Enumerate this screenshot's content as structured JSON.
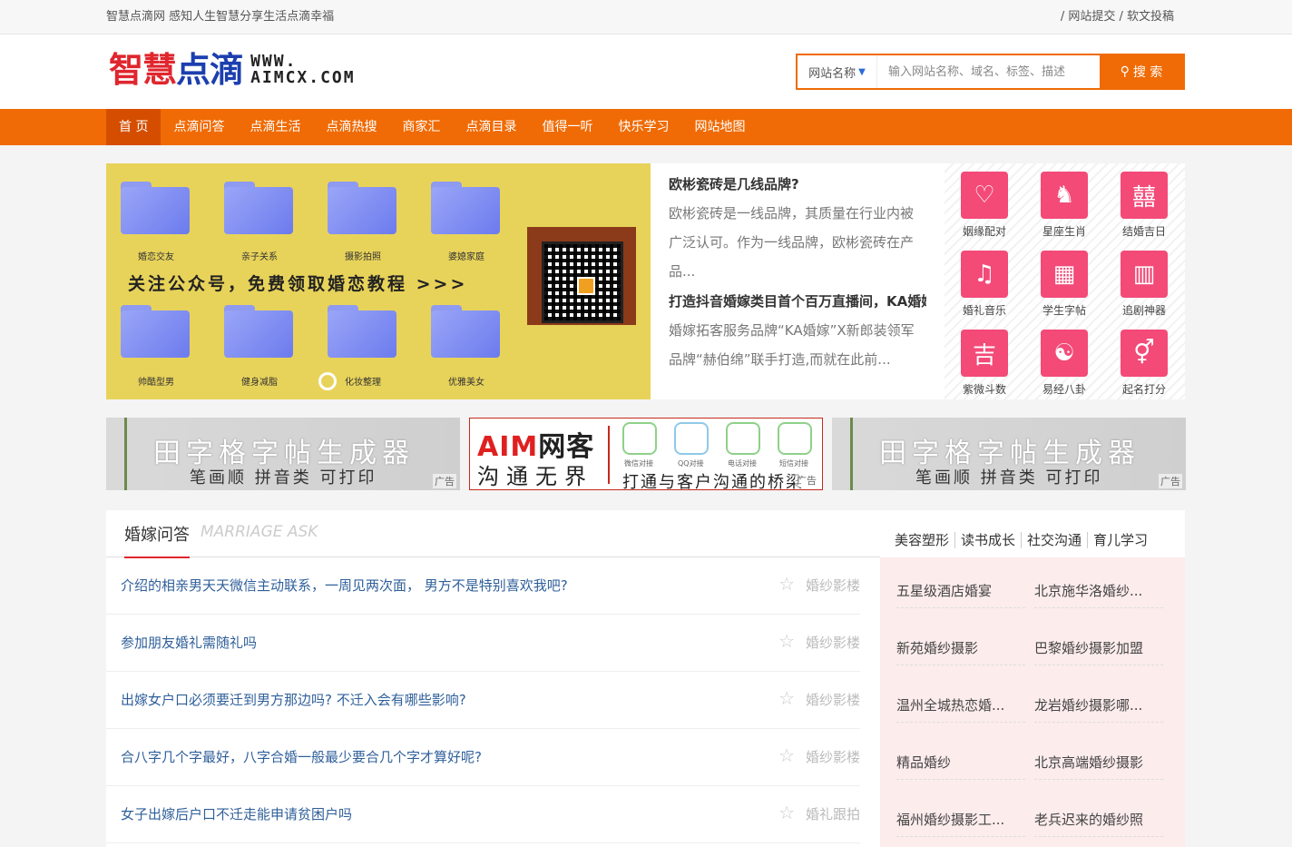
{
  "topbar": {
    "left_text": "智慧点滴网 感知人生智慧分享生活点滴幸福",
    "right_text": "/ 网站提交 / 软文投稿"
  },
  "logo": {
    "cn": [
      "智",
      "慧",
      "点",
      "滴"
    ],
    "en_line1": "WWW.",
    "en_line2": "AIMCX.COM"
  },
  "search": {
    "select_value": "网站名称",
    "placeholder": "输入网站名称、域名、标签、描述",
    "button_label": "搜 索"
  },
  "nav": {
    "items": [
      "首 页",
      "点滴问答",
      "点滴生活",
      "点滴热搜",
      "商家汇",
      "点滴目录",
      "值得一听",
      "快乐学习",
      "网站地图"
    ]
  },
  "slider": {
    "slogan": "关注公众号，免费领取婚恋教程 >>>",
    "folders": [
      "婚恋交友",
      "亲子关系",
      "摄影拍照",
      "婆媳家庭",
      "帅酷型男",
      "健身减脂",
      "化妆整理",
      "优雅美女"
    ]
  },
  "news": [
    {
      "title": "欧彬瓷砖是几线品牌?",
      "summary": "欧彬瓷砖是一线品牌，其质量在行业内被广泛认可。作为一线品牌，欧彬瓷砖在产品..."
    },
    {
      "title": "打造抖音婚嫁类目首个百万直播间，KA婚嫁",
      "summary": "婚嫁拓客服务品牌“KA婚嫁”X新郎装领军品牌“赫伯绵”联手打造,而就在此前..."
    }
  ],
  "tools": [
    {
      "label": "姻缘配对",
      "icon": "hearts-icon",
      "glyph": "♡"
    },
    {
      "label": "星座生肖",
      "icon": "horse-icon",
      "glyph": "♞"
    },
    {
      "label": "结婚吉日",
      "icon": "calendar-icon",
      "glyph": "囍"
    },
    {
      "label": "婚礼音乐",
      "icon": "music-icon",
      "glyph": "♫"
    },
    {
      "label": "学生字帖",
      "icon": "grid-calendar-icon",
      "glyph": "▦"
    },
    {
      "label": "追剧神器",
      "icon": "book-icon",
      "glyph": "▥"
    },
    {
      "label": "紫微斗数",
      "icon": "ji-calendar-icon",
      "glyph": "吉"
    },
    {
      "label": "易经八卦",
      "icon": "yinyang-icon",
      "glyph": "☯"
    },
    {
      "label": "起名打分",
      "icon": "gender-icon",
      "glyph": "⚥"
    }
  ],
  "ads": {
    "ad1": {
      "title": "田字格字帖生成器",
      "sub": "笔画顺 拼音类 可打印",
      "tag": "广告"
    },
    "ad2": {
      "brand_a": "AIM",
      "brand_b": "网客",
      "line2": "沟通无界",
      "slogan": "打通与客户沟通的桥梁",
      "channels": [
        "微信对接",
        "QQ对接",
        "电话对接",
        "短信对接"
      ],
      "tag": "广告"
    },
    "ad3": {
      "title": "田字格字帖生成器",
      "sub": "笔画顺 拼音类 可打印",
      "tag": "广告"
    }
  },
  "qa": {
    "title": "婚嫁问答",
    "subtitle": "MARRIAGE ASK",
    "rows": [
      {
        "q": "介绍的相亲男天天微信主动联系，一周见两次面， 男方不是特别喜欢我吧?",
        "cat": "婚纱影楼"
      },
      {
        "q": "参加朋友婚礼需随礼吗",
        "cat": "婚纱影楼"
      },
      {
        "q": "出嫁女户口必须要迁到男方那边吗? 不迁入会有哪些影响?",
        "cat": "婚纱影楼"
      },
      {
        "q": "合八字几个字最好，八字合婚一般最少要合几个字才算好呢?",
        "cat": "婚纱影楼"
      },
      {
        "q": "女子出嫁后户口不迁走能申请贫困户吗",
        "cat": "婚礼跟拍"
      }
    ]
  },
  "side": {
    "tabs": [
      "美容塑形",
      "读书成长",
      "社交沟通",
      "育儿学习"
    ],
    "items": [
      "五星级酒店婚宴",
      "北京施华洛婚纱...",
      "新苑婚纱摄影",
      "巴黎婚纱摄影加盟",
      "温州全城热恋婚...",
      "龙岩婚纱摄影哪...",
      "精品婚纱",
      "北京高端婚纱摄影",
      "福州婚纱摄影工...",
      "老兵迟来的婚纱照"
    ]
  }
}
